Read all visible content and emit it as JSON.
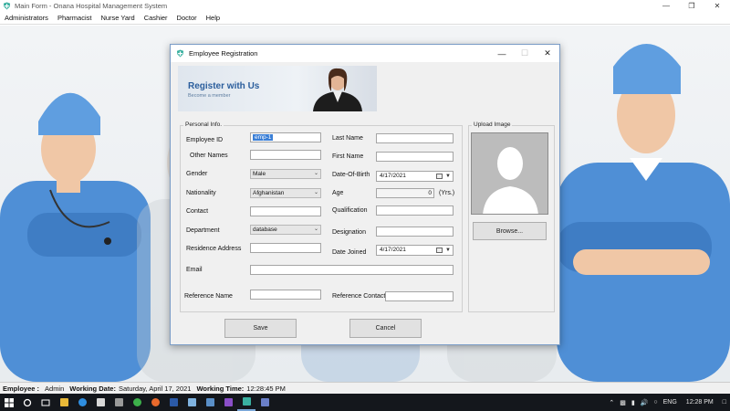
{
  "window": {
    "title": "Main Form - Onana Hospital Management System"
  },
  "menu": [
    "Administrators",
    "Pharmacist",
    "Nurse Yard",
    "Cashier",
    "Doctor",
    "Help"
  ],
  "dialog": {
    "title": "Employee Registration",
    "banner": {
      "title": "Register with Us",
      "subtitle": "Become a member"
    },
    "personal_info_label": "Personal Info.",
    "upload_label": "Upload Image",
    "fields": {
      "employee_id": {
        "label": "Employee ID",
        "value": "emp-1"
      },
      "other_names": {
        "label": "Other Names",
        "value": ""
      },
      "gender": {
        "label": "Gender",
        "value": "Male"
      },
      "nationality": {
        "label": "Nationality",
        "value": "Afghanistan"
      },
      "contact": {
        "label": "Contact",
        "value": ""
      },
      "department": {
        "label": "Department",
        "value": "database"
      },
      "residence_address": {
        "label": "Residence Address",
        "value": ""
      },
      "email": {
        "label": "Email",
        "value": ""
      },
      "reference_name": {
        "label": "Reference Name",
        "value": ""
      },
      "last_name": {
        "label": "Last Name",
        "value": ""
      },
      "first_name": {
        "label": "First Name",
        "value": ""
      },
      "dob": {
        "label": "Date-Of-Birth",
        "value": "4/17/2021"
      },
      "age": {
        "label": "Age",
        "value": "0",
        "unit": "(Yrs.)"
      },
      "qualification": {
        "label": "Qualification",
        "value": ""
      },
      "designation": {
        "label": "Designation",
        "value": ""
      },
      "date_joined": {
        "label": "Date Joined",
        "value": "4/17/2021"
      },
      "reference_contact": {
        "label": "Reference Contact",
        "value": ""
      }
    },
    "browse_label": "Browse...",
    "save_label": "Save",
    "cancel_label": "Cancel"
  },
  "status": {
    "employee_label": "Employee :",
    "employee_value": "Admin",
    "working_date_label": "Working Date:",
    "working_date_value": "Saturday, April 17, 2021",
    "working_time_label": "Working Time:",
    "working_time_value": "12:28:45 PM"
  },
  "taskbar": {
    "language": "ENG",
    "clock": "12:28 PM",
    "apps": [
      "start-icon",
      "search-icon",
      "task-view-icon",
      "file-explorer-icon",
      "edge-icon",
      "store-icon",
      "calculator-icon",
      "chrome-icon",
      "firefox-icon",
      "word-icon",
      "notepad-icon",
      "photos-icon",
      "visual-studio-icon",
      "hospital-app-icon",
      "app-icon"
    ]
  },
  "colors": {
    "accent": "#2a5d9c",
    "scrub_blue": "#4f8fd6",
    "taskbar": "#14171c"
  }
}
